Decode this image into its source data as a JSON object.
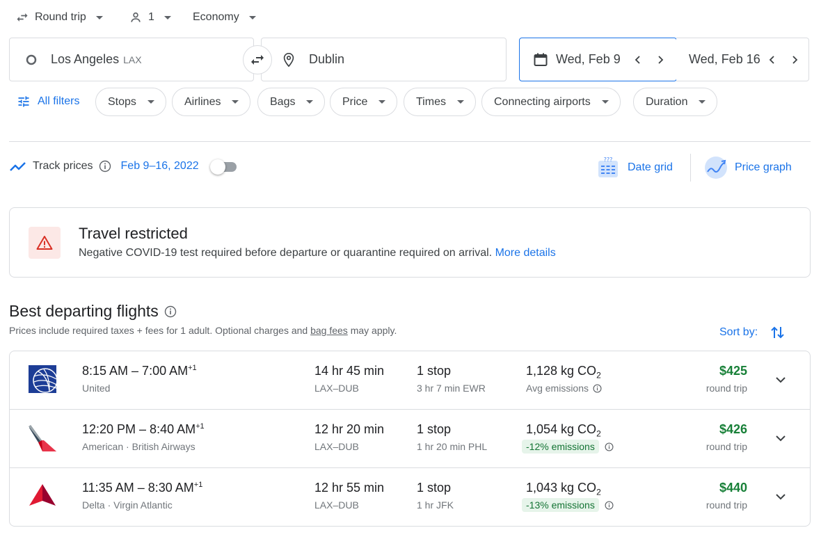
{
  "search": {
    "trip_type": "Round trip",
    "passengers": "1",
    "cabin": "Economy",
    "origin_city": "Los Angeles",
    "origin_code": "LAX",
    "destination": "Dublin",
    "depart_date": "Wed, Feb 9",
    "return_date": "Wed, Feb 16"
  },
  "filters": {
    "all_filters": "All filters",
    "chips": [
      "Stops",
      "Airlines",
      "Bags",
      "Price",
      "Times",
      "Connecting airports",
      "Duration"
    ]
  },
  "tracking": {
    "label": "Track prices",
    "date_range": "Feb 9–16, 2022",
    "date_grid": "Date grid",
    "price_graph": "Price graph"
  },
  "restriction": {
    "title": "Travel restricted",
    "message": "Negative COVID-19 test required before departure or quarantine required on arrival.",
    "link": "More details"
  },
  "results": {
    "heading": "Best departing flights",
    "note_before": "Prices include required taxes + fees for 1 adult. Optional charges and",
    "note_link": "bag fees",
    "note_after": "may apply.",
    "sort_label": "Sort by:",
    "flights": [
      {
        "times": "8:15 AM – 7:00 AM",
        "day_offset": "+1",
        "airline": "United",
        "duration": "14 hr 45 min",
        "route": "LAX–DUB",
        "stops": "1 stop",
        "layover": "3 hr 7 min EWR",
        "emissions": "1,128 kg CO",
        "emissions_sub": "2",
        "emissions_note": "Avg emissions",
        "price": "$425",
        "price_note": "round trip"
      },
      {
        "times": "12:20 PM – 8:40 AM",
        "day_offset": "+1",
        "airline": "American · British Airways",
        "duration": "12 hr 20 min",
        "route": "LAX–DUB",
        "stops": "1 stop",
        "layover": "1 hr 20 min PHL",
        "emissions": "1,054 kg CO",
        "emissions_sub": "2",
        "emissions_note": "-12% emissions",
        "price": "$426",
        "price_note": "round trip"
      },
      {
        "times": "11:35 AM – 8:30 AM",
        "day_offset": "+1",
        "airline": "Delta · Virgin Atlantic",
        "duration": "12 hr 55 min",
        "route": "LAX–DUB",
        "stops": "1 stop",
        "layover": "1 hr JFK",
        "emissions": "1,043 kg CO",
        "emissions_sub": "2",
        "emissions_note": "-13% emissions",
        "price": "$440",
        "price_note": "round trip"
      }
    ]
  },
  "colors": {
    "accent": "#1a73e8",
    "price_green": "#188038",
    "emission_badge_bg": "#e6f4ea",
    "warning_red": "#d93025"
  }
}
